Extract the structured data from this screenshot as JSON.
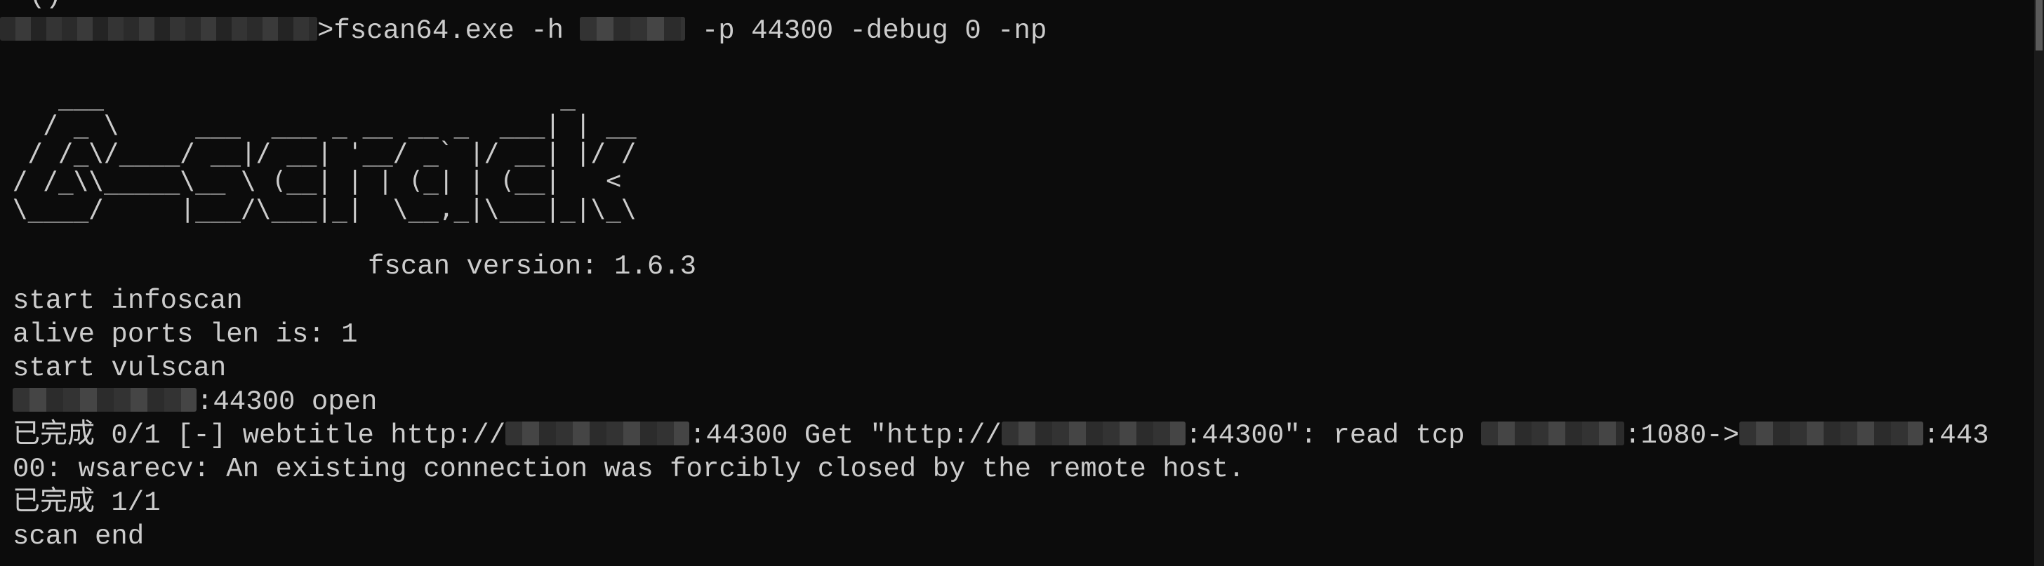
{
  "terminal": {
    "top_fragment": "'()",
    "command": {
      "prompt_suffix": ">",
      "executable": "fscan64.exe -h ",
      "args": " -p 44300 -debug 0 -np"
    },
    "ascii_art": "   ___                              _\n  / _ \\     ___  ___ _ __ __ _  ___| | __\n / /_\\/____/ __|/ __| '__/ _` |/ __| |/ /\n/ /_\\\\_____\\__ \\ (__| | | (_| | (__|   <\n\\____/     |___/\\___|_|  \\__,_|\\___|_|\\_\\",
    "version": "fscan version: 1.6.3",
    "lines": {
      "start_infoscan": "start infoscan",
      "alive_ports": "alive ports len is: 1",
      "start_vulscan": "start vulscan",
      "open_port": ":44300 open",
      "progress_prefix": "已完成 0/1 [-] webtitle http://",
      "progress_part2": ":44300 Get \"http://",
      "progress_part3": ":44300\": read tcp ",
      "progress_part4": ":1080->",
      "progress_part5": ":443",
      "error_cont": "00: wsarecv: An existing connection was forcibly closed by the remote host.",
      "done": "已完成 1/1",
      "scan_end": "scan end"
    }
  }
}
